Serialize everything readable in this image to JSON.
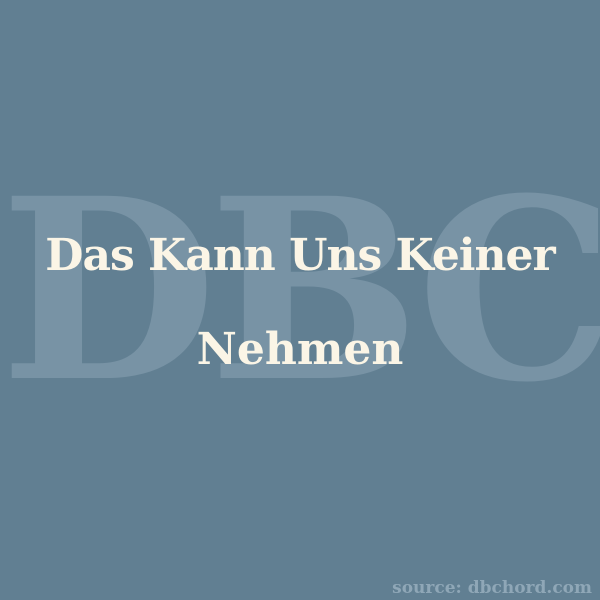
{
  "watermark": {
    "text": "DBC"
  },
  "title": {
    "line1": "Das Kann Uns Keiner",
    "line2": "Nehmen"
  },
  "source": {
    "text": "source: dbchord.com"
  },
  "colors": {
    "background": "#617f92",
    "watermark": "#7893a5",
    "title": "#fbf5e6",
    "source": "#8fa7b7"
  }
}
